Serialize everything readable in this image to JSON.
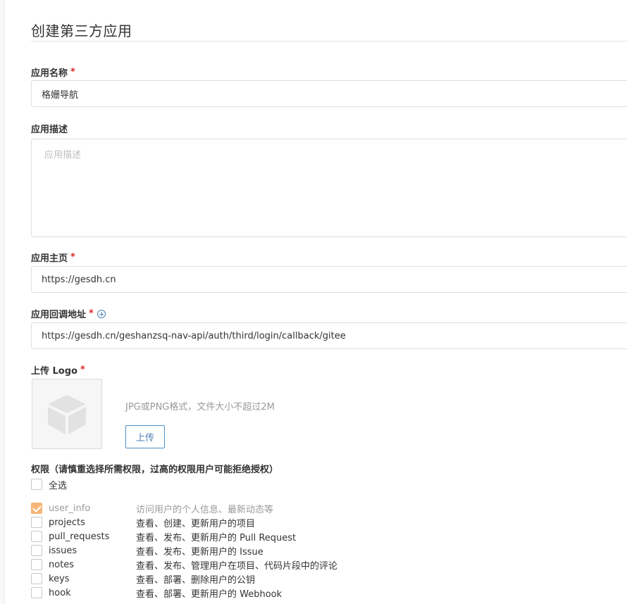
{
  "page": {
    "title": "创建第三方应用"
  },
  "form": {
    "app_name": {
      "label": "应用名称",
      "required_mark": "*",
      "value": "格姗导航"
    },
    "app_desc": {
      "label": "应用描述",
      "placeholder": "应用描述",
      "value": ""
    },
    "homepage": {
      "label": "应用主页",
      "required_mark": "*",
      "value": "https://gesdh.cn"
    },
    "callback": {
      "label": "应用回调地址",
      "required_mark": "*",
      "value": "https://gesdh.cn/geshanzsq-nav-api/auth/third/login/callback/gitee"
    },
    "logo": {
      "label": "上传 Logo",
      "required_mark": "*",
      "hint": "JPG或PNG格式，文件大小不超过2M",
      "upload_label": "上传"
    }
  },
  "permissions": {
    "title": "权限（请慎重选择所需权限，过高的权限用户可能拒绝授权）",
    "select_all": {
      "label": "全选",
      "checked": false
    },
    "items": [
      {
        "name": "user_info",
        "desc": "访问用户的个人信息、最新动态等",
        "checked": true,
        "disabled": true
      },
      {
        "name": "projects",
        "desc": "查看、创建、更新用户的项目",
        "checked": false
      },
      {
        "name": "pull_requests",
        "desc": "查看、发布、更新用户的 Pull Request",
        "checked": false
      },
      {
        "name": "issues",
        "desc": "查看、发布、更新用户的 Issue",
        "checked": false
      },
      {
        "name": "notes",
        "desc": "查看、发布、管理用户在项目、代码片段中的评论",
        "checked": false
      },
      {
        "name": "keys",
        "desc": "查看、部署、删除用户的公钥",
        "checked": false
      },
      {
        "name": "hook",
        "desc": "查看、部署、更新用户的 Webhook",
        "checked": false
      }
    ]
  },
  "colors": {
    "required": "#db2828",
    "accent": "#4a7fb5",
    "checked": "#f5b67a"
  }
}
